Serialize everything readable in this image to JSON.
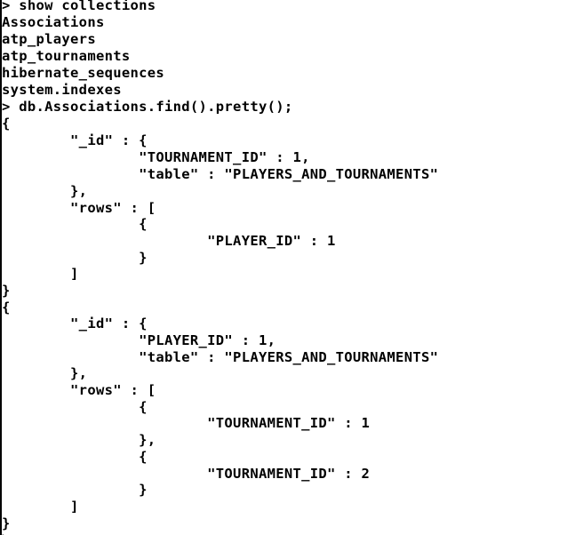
{
  "terminal": {
    "lines": [
      "> show collections",
      "Associations",
      "atp_players",
      "atp_tournaments",
      "hibernate_sequences",
      "system.indexes",
      "> db.Associations.find().pretty();",
      "{",
      "        \"_id\" : {",
      "                \"TOURNAMENT_ID\" : 1,",
      "                \"table\" : \"PLAYERS_AND_TOURNAMENTS\"",
      "        },",
      "        \"rows\" : [",
      "                {",
      "                        \"PLAYER_ID\" : 1",
      "                }",
      "        ]",
      "}",
      "{",
      "        \"_id\" : {",
      "                \"PLAYER_ID\" : 1,",
      "                \"table\" : \"PLAYERS_AND_TOURNAMENTS\"",
      "        },",
      "        \"rows\" : [",
      "                {",
      "                        \"TOURNAMENT_ID\" : 1",
      "                },",
      "                {",
      "                        \"TOURNAMENT_ID\" : 2",
      "                }",
      "        ]",
      "}",
      ">"
    ]
  }
}
